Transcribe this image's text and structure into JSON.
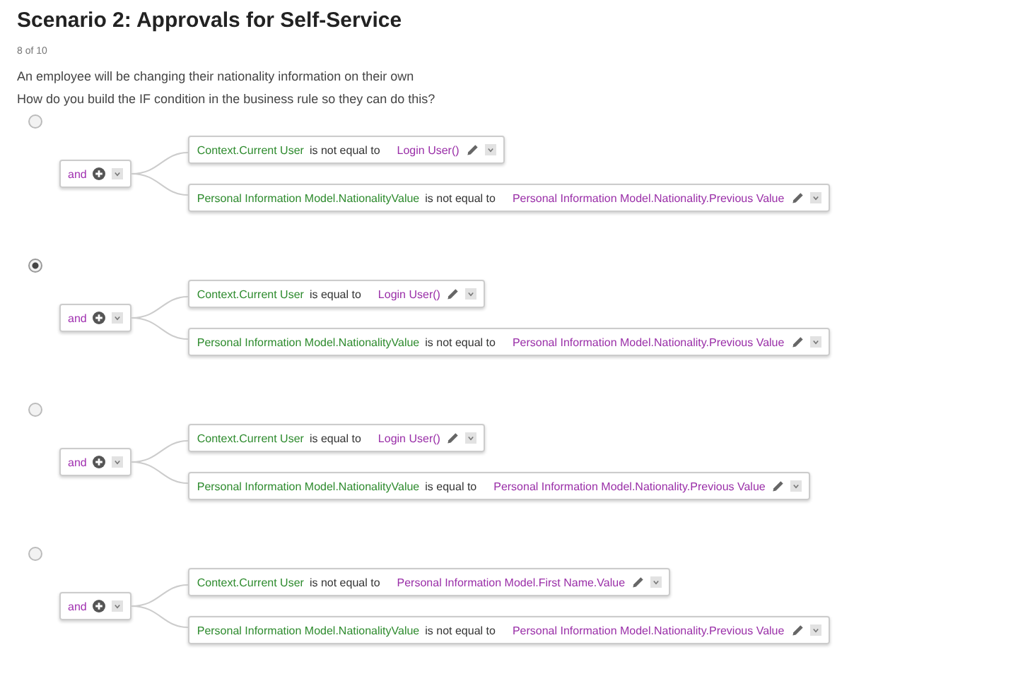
{
  "title": "Scenario 2: Approvals for Self-Service",
  "progress": "8  of 10",
  "paragraphs": [
    "An employee will be changing their nationality information on their own",
    "How do you build the IF condition in the business rule so they can do this?"
  ],
  "options": [
    {
      "selected": false,
      "operator": "and",
      "conditions": [
        {
          "left": "Context.Current User",
          "op": "is not equal to",
          "right": "Login User()"
        },
        {
          "left": "Personal Information Model.NationalityValue",
          "op": "is not equal to",
          "right": "Personal Information Model.Nationality.Previous Value"
        }
      ]
    },
    {
      "selected": true,
      "operator": "and",
      "conditions": [
        {
          "left": "Context.Current User",
          "op": "is equal to",
          "right": "Login User()"
        },
        {
          "left": "Personal Information Model.NationalityValue",
          "op": "is not equal to",
          "right": "Personal Information Model.Nationality.Previous Value"
        }
      ]
    },
    {
      "selected": false,
      "operator": "and",
      "conditions": [
        {
          "left": "Context.Current User",
          "op": "is equal to",
          "right": "Login User()"
        },
        {
          "left": "Personal Information Model.NationalityValue",
          "op": "is equal to",
          "right": "Personal Information Model.Nationality.Previous Value"
        }
      ]
    },
    {
      "selected": false,
      "operator": "and",
      "conditions": [
        {
          "left": "Context.Current User",
          "op": "is not equal to",
          "right": "Personal Information Model.First Name.Value"
        },
        {
          "left": "Personal Information Model.NationalityValue",
          "op": "is not equal to",
          "right": "Personal Information Model.Nationality.Previous Value"
        }
      ]
    }
  ]
}
